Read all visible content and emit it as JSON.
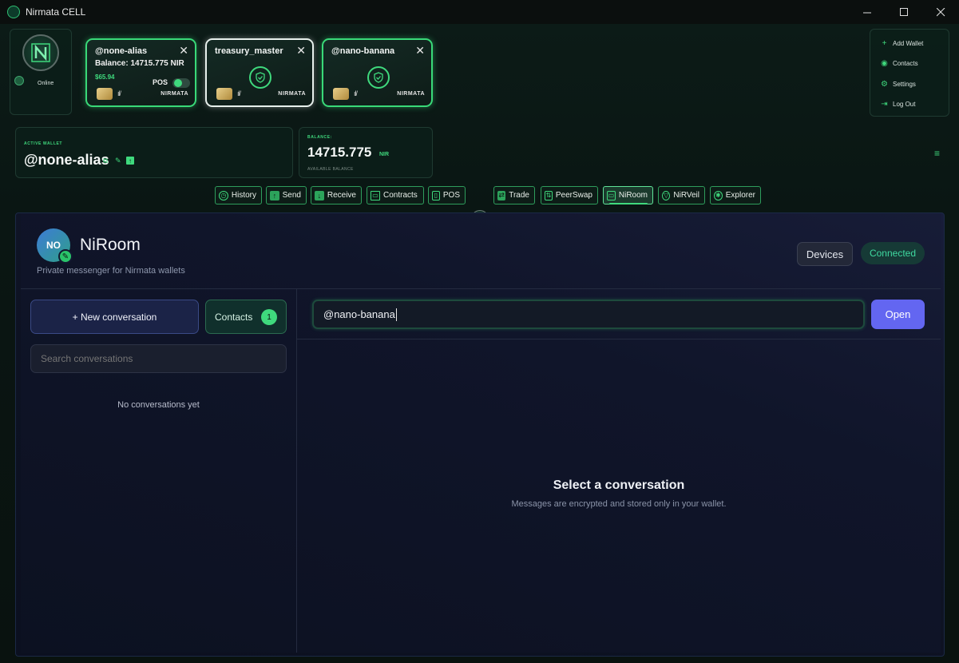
{
  "window": {
    "title": "Nirmata CELL"
  },
  "profile": {
    "status": "Online"
  },
  "wallet_cards": [
    {
      "alias": "@none-alias",
      "balance_line": "Balance: 14715.775 NIR",
      "usd": "$65.94",
      "pos_label": "POS",
      "brand": "NIRMATA"
    },
    {
      "alias": "treasury_master",
      "brand": "NIRMATA"
    },
    {
      "alias": "@nano-banana",
      "brand": "NIRMATA"
    }
  ],
  "right_menu": [
    {
      "icon": "plus-icon",
      "label": "Add Wallet"
    },
    {
      "icon": "user-circle-icon",
      "label": "Contacts"
    },
    {
      "icon": "gear-icon",
      "label": "Settings"
    },
    {
      "icon": "logout-icon",
      "label": "Log Out"
    }
  ],
  "active_wallet": {
    "caption": "ACTIVE WALLET",
    "alias": "@none-alias"
  },
  "balance": {
    "caption": "BALANCE:",
    "amount": "14715.775",
    "unit": "NIR",
    "sub": "AVAILABLE BALANCE"
  },
  "nav": [
    {
      "label": "History",
      "icon": "clock-icon"
    },
    {
      "label": "Send",
      "icon": "arrow-up-icon"
    },
    {
      "label": "Receive",
      "icon": "arrow-down-icon"
    },
    {
      "label": "Contracts",
      "icon": "document-icon"
    },
    {
      "label": "POS",
      "icon": "pos-terminal-icon"
    },
    {
      "label": "Trade",
      "icon": "trade-arrows-icon"
    },
    {
      "label": "PeerSwap",
      "icon": "swap-icon"
    },
    {
      "label": "NiRoom",
      "icon": "chat-icon"
    },
    {
      "label": "NiRVeil",
      "icon": "veil-icon"
    },
    {
      "label": "Explorer",
      "icon": "compass-icon"
    }
  ],
  "niroom": {
    "avatar_initials": "NO",
    "title": "NiRoom",
    "subtitle": "Private messenger for Nirmata wallets",
    "devices_label": "Devices",
    "status_label": "Connected",
    "new_conversation_label": "+ New conversation",
    "contacts_label": "Contacts",
    "contacts_count": "1",
    "search_placeholder": "Search conversations",
    "empty_list": "No conversations yet",
    "recipient_value": "@nano-banana",
    "open_label": "Open",
    "empty_title": "Select a conversation",
    "empty_sub": "Messages are encrypted and stored only in your wallet."
  }
}
